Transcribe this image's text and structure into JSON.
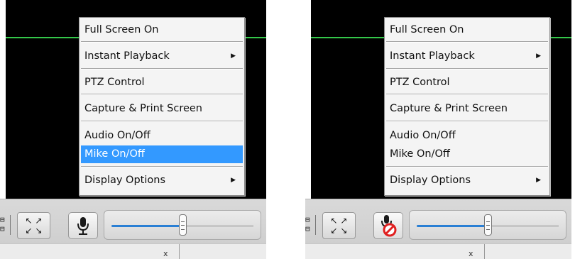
{
  "menu": {
    "items": [
      {
        "label": "Full Screen On",
        "submenu": false
      },
      {
        "label": "Instant Playback",
        "submenu": true
      },
      {
        "label": "PTZ Control",
        "submenu": false
      },
      {
        "label": "Capture & Print Screen",
        "submenu": false
      },
      {
        "label": "Audio On/Off",
        "submenu": false
      },
      {
        "label": "Mike On/Off",
        "submenu": false
      },
      {
        "label": "Display Options",
        "submenu": true
      }
    ],
    "submenu_arrow": "▶"
  },
  "panels": [
    {
      "highlighted_item": "Mike On/Off",
      "mic_state": "on",
      "volume_level": 0.5
    },
    {
      "highlighted_item": null,
      "mic_state": "muted",
      "volume_level": 0.5
    }
  ],
  "toolbar": {
    "expand_glyphs": [
      "↖ ↗",
      "↙ ↘"
    ],
    "layout_glyphs": [
      "⊟",
      "⊟"
    ],
    "close_label": "x"
  },
  "colors": {
    "video_bg": "#000000",
    "green_line": "#34c84a",
    "highlight": "#3399ff",
    "volume_fill": "#2a7fd4",
    "mute_red": "#e02020"
  }
}
